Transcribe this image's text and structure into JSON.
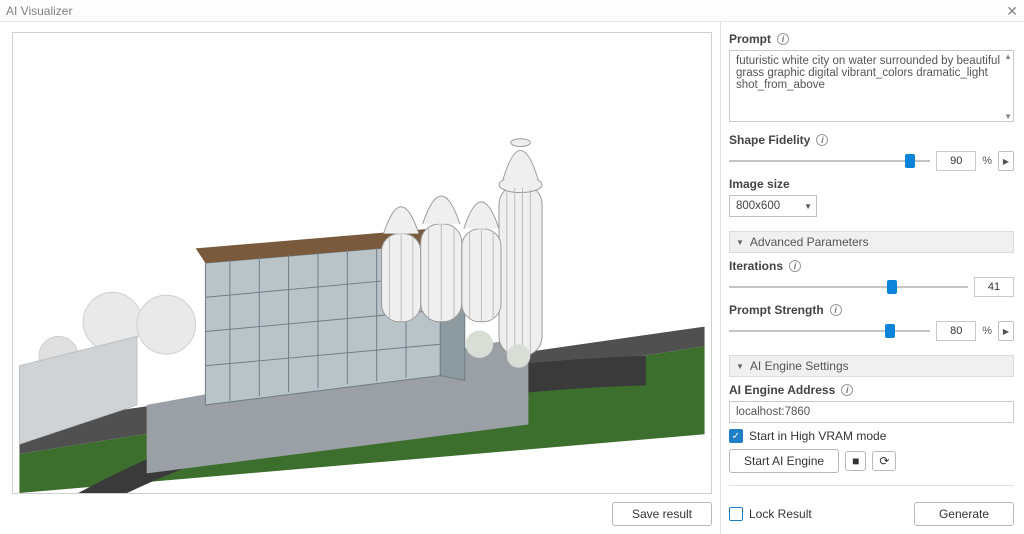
{
  "window": {
    "title": "AI Visualizer"
  },
  "left": {
    "save_btn": "Save result"
  },
  "panel": {
    "prompt_label": "Prompt",
    "prompt_value": "futuristic white city on water surrounded by beautiful grass graphic digital vibrant_colors dramatic_light shot_from_above",
    "shape_fidelity_label": "Shape Fidelity",
    "shape_fidelity_value": "90",
    "pct": "%",
    "image_size_label": "Image size",
    "image_size_value": "800x600",
    "advanced_header": "Advanced Parameters",
    "iterations_label": "Iterations",
    "iterations_value": "41",
    "prompt_strength_label": "Prompt Strength",
    "prompt_strength_value": "80",
    "engine_header": "AI Engine Settings",
    "engine_addr_label": "AI Engine Address",
    "engine_addr_value": "localhost:7860",
    "high_vram_label": "Start in High VRAM mode",
    "start_engine_btn": "Start AI Engine",
    "lock_result_label": "Lock Result",
    "generate_btn": "Generate"
  }
}
